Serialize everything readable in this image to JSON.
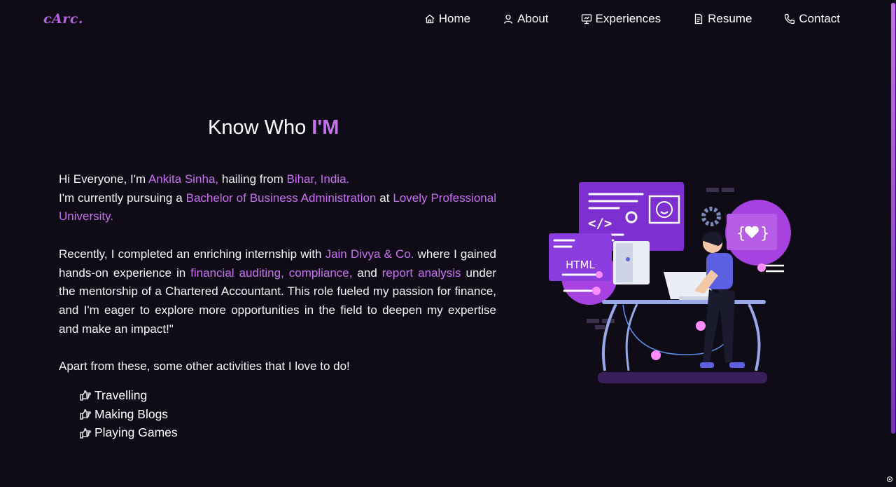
{
  "logo": "cArc.",
  "nav": {
    "items": [
      {
        "label": "Home",
        "icon": "home-icon"
      },
      {
        "label": "About",
        "icon": "user-icon"
      },
      {
        "label": "Experiences",
        "icon": "presentation-icon"
      },
      {
        "label": "Resume",
        "icon": "document-icon"
      },
      {
        "label": "Contact",
        "icon": "phone-icon"
      }
    ]
  },
  "heading": {
    "prefix": "Know Who ",
    "accent": "I'M"
  },
  "intro": {
    "p1_a": "Hi Everyone, I'm ",
    "name": "Ankita Sinha,",
    "p1_b": " hailing from ",
    "place": "Bihar, India.",
    "p1_c": "I'm currently pursuing a ",
    "degree": "Bachelor of Business Administration",
    "p1_d": " at ",
    "university": "Lovely Professional University."
  },
  "internship": {
    "a": "Recently, I completed an enriching internship with ",
    "company": "Jain Divya & Co.",
    "b": " where I gained hands-on experience in ",
    "skills": "financial auditing, compliance,",
    "c": " and ",
    "skill2": "report analysis",
    "d": " under the mentorship of a Chartered Accountant. This role fueled my passion for finance, and I'm eager to explore more opportunities in the field to deepen my expertise and make an impact!\""
  },
  "activities_intro": "Apart from these, some other activities that I love to do!",
  "activities": [
    "Travelling",
    "Making Blogs",
    "Playing Games"
  ],
  "illustration": {
    "html_label": "HTML"
  },
  "colors": {
    "accent": "#c770f0",
    "background": "#0f0c17",
    "text": "#ffffff"
  }
}
